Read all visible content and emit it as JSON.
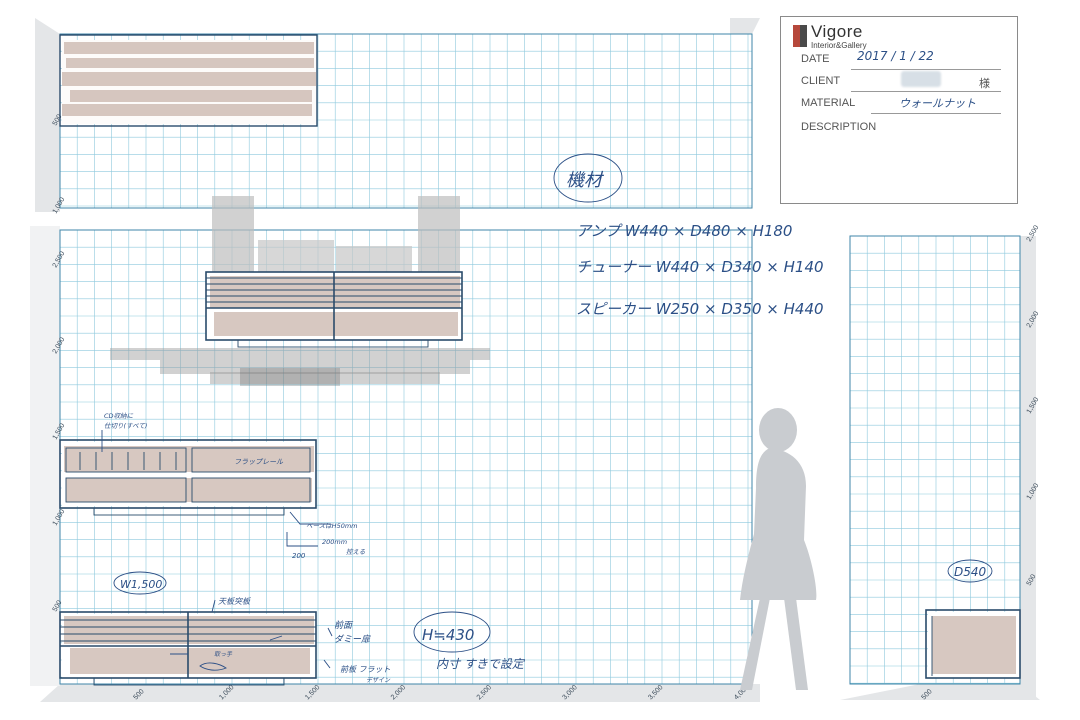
{
  "title_block": {
    "brand": "Vigore",
    "brand_sub": "Interior&Gallery",
    "date_label": "DATE",
    "date_value": "2017 /   1   / 22",
    "client_label": "CLIENT",
    "client_suffix": "様",
    "material_label": "MATERIAL",
    "material_value": "ウォールナット",
    "description_label": "DESCRIPTION"
  },
  "notes": {
    "material_heading": "機材",
    "amp": "アンプ  W440 × D480 × H180",
    "tuner": "チューナー  W440 × D340 × H140",
    "speaker": "スピーカー  W250 × D350 × H440",
    "cd_note_1": "CD収納に",
    "cd_note_2": "仕切り(すべて)",
    "flap": "フラップレール",
    "base_note_1": "ベースはH50mm",
    "base_note_2": "200mm",
    "base_note_3": "控える",
    "base_dim": "200",
    "width": "W1,500",
    "top_board": "天板突板",
    "front_1": "前面",
    "front_2": "ダミー扉",
    "handle": "取っ手",
    "flat_1": "前板 フラット",
    "flat_2": "デザイン",
    "height": "H≒430",
    "interior": "内寸 すきで設定",
    "depth": "D540"
  },
  "axes": {
    "x_ticks": [
      "500",
      "1,000",
      "1,500",
      "2,000",
      "2,500",
      "3,000",
      "3,500",
      "4,000"
    ],
    "y_ticks_left": [
      "500",
      "1,000",
      "1,500",
      "2,000",
      "2,500"
    ],
    "y_ticks_top": [
      "500",
      "1,000"
    ],
    "y_ticks_right": [
      "500",
      "1,000",
      "1,500",
      "2,000",
      "2,500"
    ],
    "x_ticks_side": [
      "500"
    ]
  },
  "colors": {
    "grid_line": "#8ec9dd",
    "grid_border": "#3f86a8",
    "ink": "#2b4f86",
    "cabinet": "#2a4b6b",
    "wood": "#b79b8e",
    "silhouette": "#c9ccd0",
    "shadow": "#e4e6e8"
  }
}
